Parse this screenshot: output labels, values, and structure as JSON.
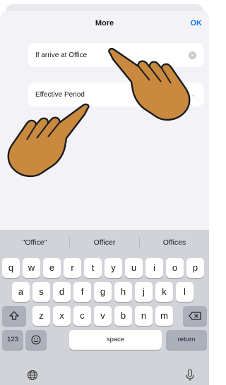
{
  "header": {
    "title": "More",
    "ok_label": "OK"
  },
  "form": {
    "condition_value": "If arrive at Office",
    "period_label": "Effective Period"
  },
  "keyboard": {
    "suggestions": [
      "\"Office\"",
      "Officer",
      "Offices"
    ],
    "row1": [
      "q",
      "w",
      "e",
      "r",
      "t",
      "y",
      "u",
      "i",
      "o",
      "p"
    ],
    "row2": [
      "a",
      "s",
      "d",
      "f",
      "g",
      "h",
      "j",
      "k",
      "l"
    ],
    "row3": [
      "z",
      "x",
      "c",
      "v",
      "b",
      "n",
      "m"
    ],
    "numbers_label": "123",
    "space_label": "space",
    "return_label": "return",
    "icons": {
      "shift": "shift-icon",
      "delete": "delete-icon",
      "emoji": "emoji-icon",
      "globe": "globe-icon",
      "mic": "microphone-icon"
    }
  },
  "colors": {
    "accent": "#1677ff",
    "sheet_bg": "#f2f2f7",
    "keyboard_bg": "#d1d3d9",
    "hand_fill": "#c98a3f"
  }
}
